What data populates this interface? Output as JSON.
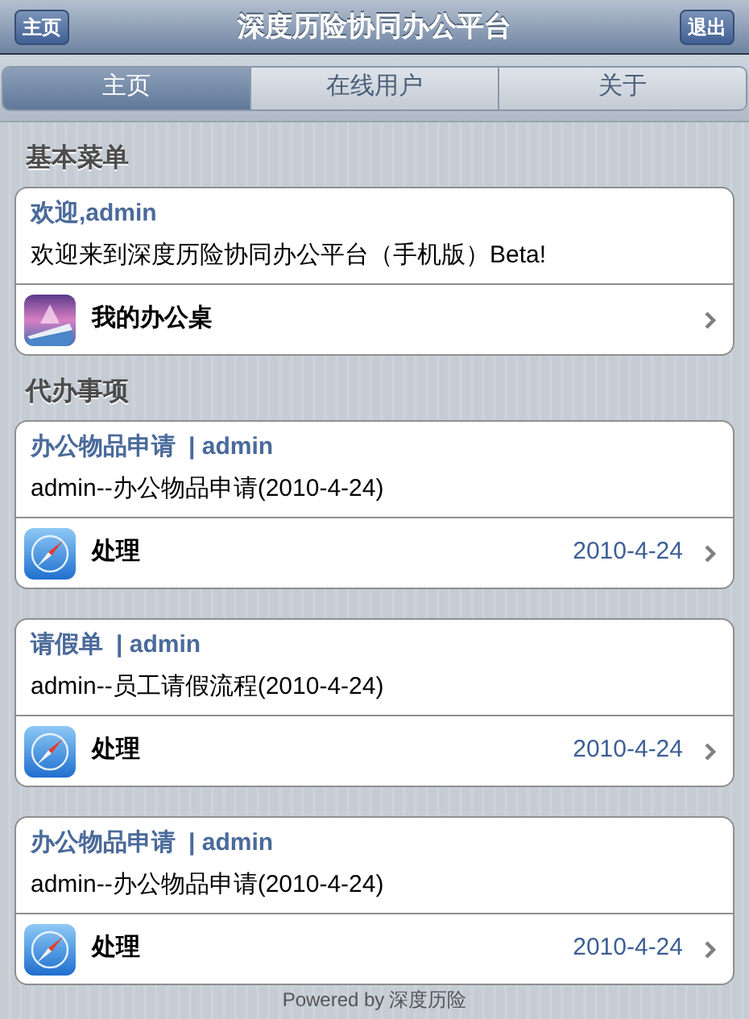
{
  "header": {
    "left_button": "主页",
    "title": "深度历险协同办公平台",
    "right_button": "退出"
  },
  "tabs": [
    {
      "label": "主页",
      "selected": true
    },
    {
      "label": "在线用户",
      "selected": false
    },
    {
      "label": "关于",
      "selected": false
    }
  ],
  "sections": [
    {
      "title": "基本菜单",
      "cards": [
        {
          "kind": "welcome",
          "title": "欢迎,admin",
          "text": "欢迎来到深度历险协同办公平台（手机版）Beta!",
          "action": "我的办公桌"
        }
      ]
    },
    {
      "title": "代办事项",
      "cards": [
        {
          "kind": "task",
          "title": "办公物品申请",
          "user": "| admin",
          "text": "admin--办公物品申请(2010-4-24)",
          "action": "处理",
          "date": "2010-4-24"
        },
        {
          "kind": "task",
          "title": "请假单",
          "user": "| admin",
          "text": "admin--员工请假流程(2010-4-24)",
          "action": "处理",
          "date": "2010-4-24"
        },
        {
          "kind": "task",
          "title": "办公物品申请",
          "user": "| admin",
          "text": "admin--办公物品申请(2010-4-24)",
          "action": "处理",
          "date": "2010-4-24"
        }
      ]
    }
  ],
  "footer": {
    "prefix": "Powered by",
    "brand": "深度历险"
  }
}
